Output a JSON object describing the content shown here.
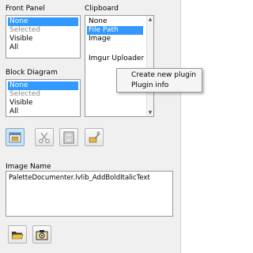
{
  "front_panel": {
    "label": "Front Panel",
    "items": [
      "None",
      "Selected",
      "Visible",
      "All"
    ],
    "selected": "None"
  },
  "block_diagram": {
    "label": "Block Diagram",
    "items": [
      "None",
      "Selected",
      "Visible",
      "All"
    ],
    "selected": "None"
  },
  "clipboard": {
    "label": "Clipboard",
    "items": [
      "None",
      "File Path",
      "Image",
      "Imgur Uploader"
    ],
    "selected": "File Path"
  },
  "context_menu": {
    "items": [
      "Create new plugin",
      "Plugin info"
    ]
  },
  "toolbar": {
    "icons": [
      "screenshot-icon",
      "scissors-icon",
      "clipboard-icon",
      "paint-bucket-icon"
    ]
  },
  "image_name": {
    "label": "Image Name",
    "value": "PaletteDocumenter.lvlib_AddBoldItalicText"
  },
  "bottom_buttons": {
    "icons": [
      "open-folder-icon",
      "camera-icon"
    ]
  },
  "colors": {
    "selection": "#3399ff",
    "panel_background": "#f0f0f0",
    "disabled_text": "#8a8a8a"
  }
}
